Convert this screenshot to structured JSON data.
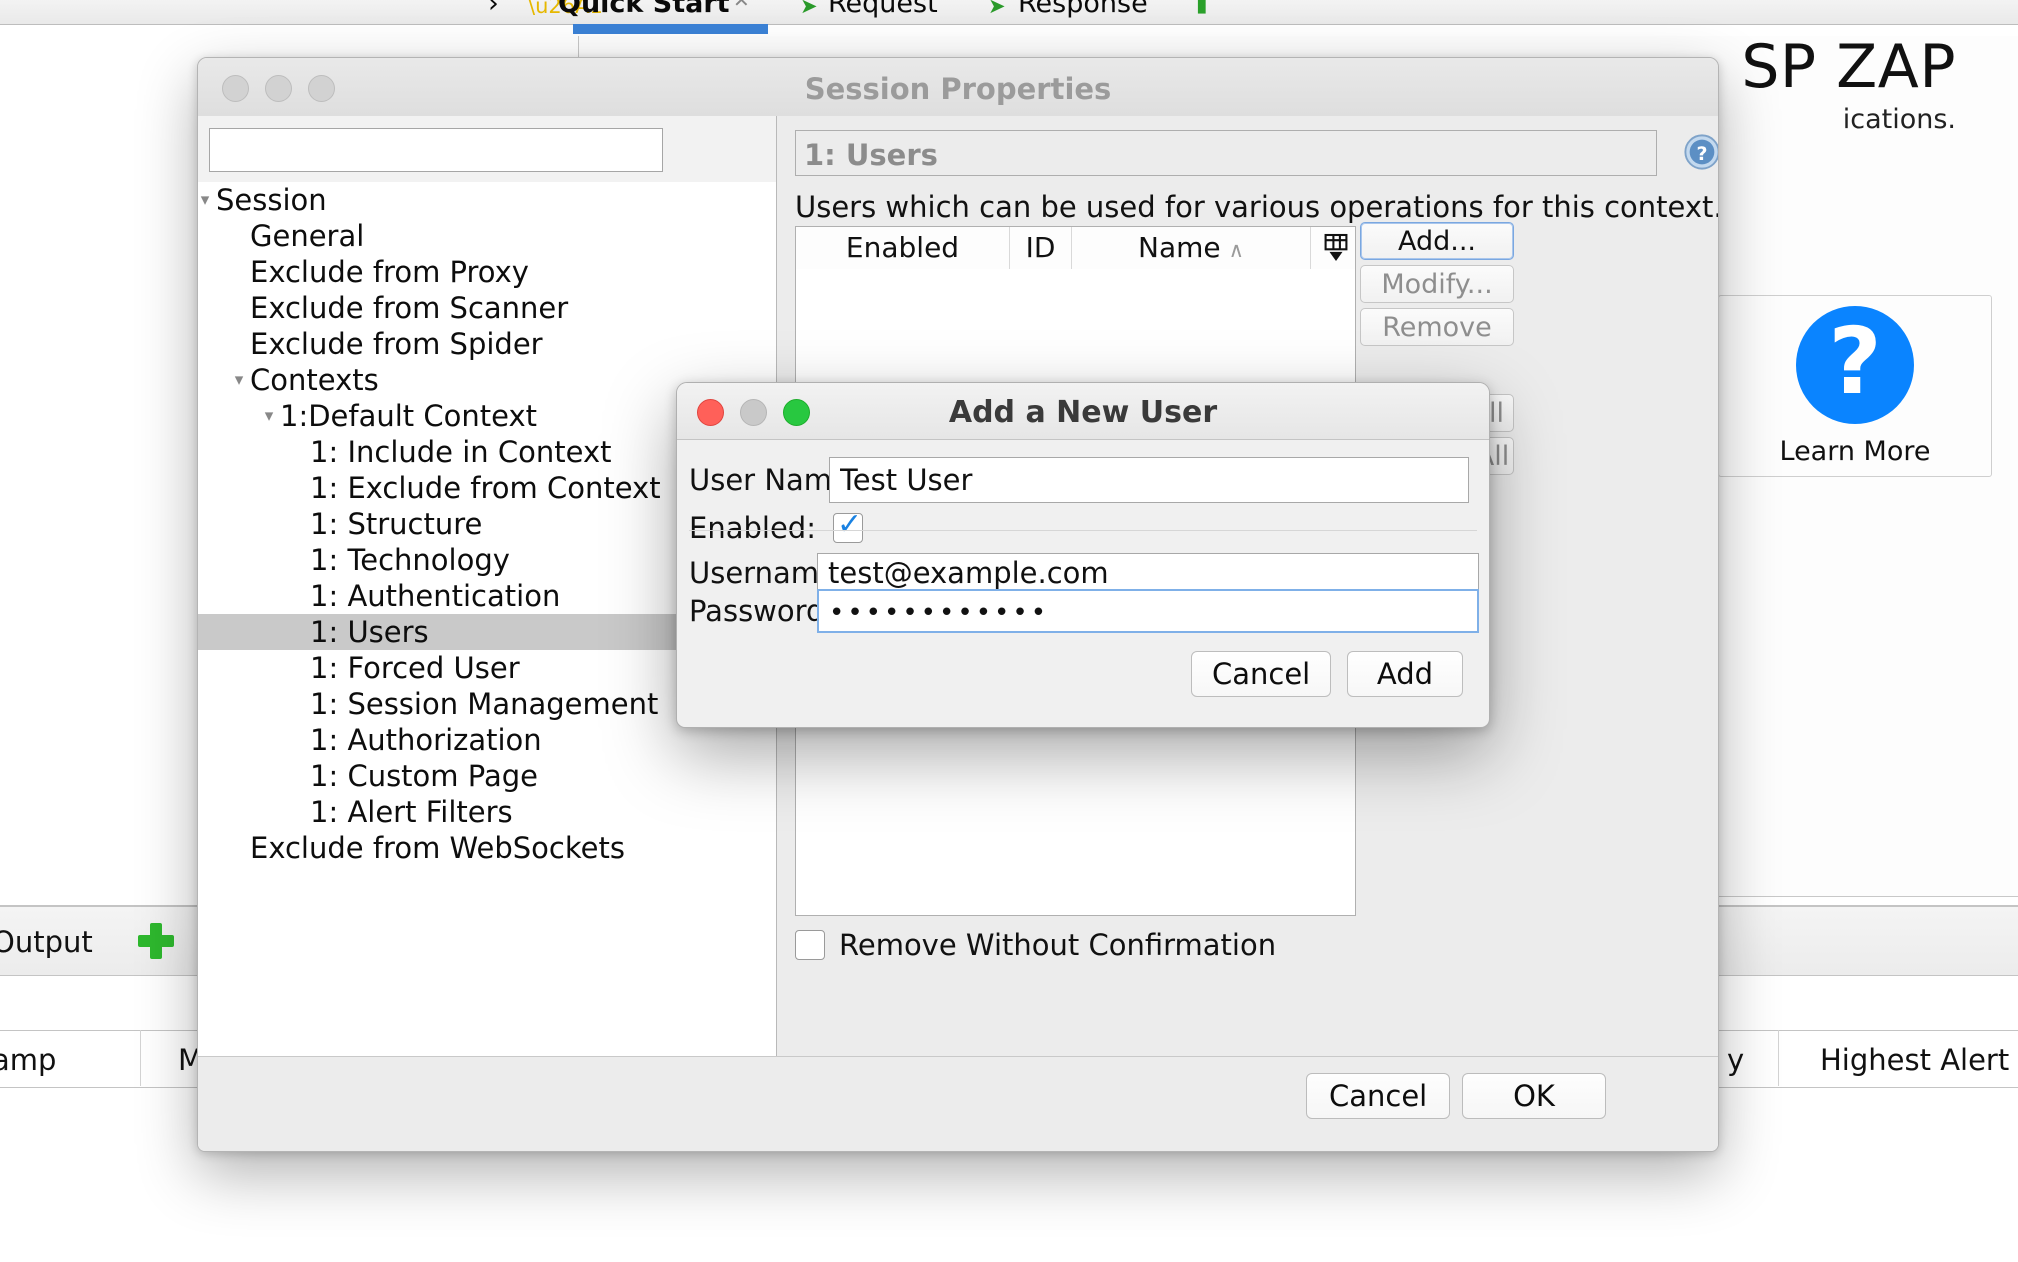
{
  "background": {
    "tabs": [
      {
        "label": "Quick Start",
        "icon": "lightning-icon",
        "selected": true
      },
      {
        "label": "Request",
        "icon": "green-arrow-right-icon",
        "selected": false
      },
      {
        "label": "Response",
        "icon": "green-arrow-left-icon",
        "selected": false
      }
    ],
    "chevron": "›",
    "app_title": "SP ZAP",
    "app_subtitle": "ications.",
    "learn_more_label": "Learn More",
    "learn_more_icon": "question-mark-icon",
    "output_tab_label": "Output",
    "add_tab_icon": "green-plus-icon",
    "table_headers": [
      {
        "label": "amp"
      },
      {
        "label": "M"
      },
      {
        "label": "y"
      },
      {
        "label": "Highest Alert"
      }
    ]
  },
  "session_properties": {
    "title": "Session Properties",
    "search": {
      "value": "",
      "placeholder": "",
      "search_icon": "magnifier-icon",
      "clear_icon": "red-x-icon"
    },
    "tree": [
      {
        "label": "Session",
        "depth": 0,
        "caret": "⌄",
        "selected": false
      },
      {
        "label": "General",
        "depth": 1,
        "caret": "",
        "selected": false
      },
      {
        "label": "Exclude from Proxy",
        "depth": 1,
        "caret": "",
        "selected": false
      },
      {
        "label": "Exclude from Scanner",
        "depth": 1,
        "caret": "",
        "selected": false
      },
      {
        "label": "Exclude from Spider",
        "depth": 1,
        "caret": "",
        "selected": false
      },
      {
        "label": "Contexts",
        "depth": 1,
        "caret": "⌄",
        "selected": false
      },
      {
        "label": "1:Default Context",
        "depth": 2,
        "caret": "⌄",
        "selected": false
      },
      {
        "label": "1: Include in Context",
        "depth": 3,
        "caret": "",
        "selected": false
      },
      {
        "label": "1: Exclude from Context",
        "depth": 3,
        "caret": "",
        "selected": false
      },
      {
        "label": "1: Structure",
        "depth": 3,
        "caret": "",
        "selected": false
      },
      {
        "label": "1: Technology",
        "depth": 3,
        "caret": "",
        "selected": false
      },
      {
        "label": "1: Authentication",
        "depth": 3,
        "caret": "",
        "selected": false
      },
      {
        "label": "1: Users",
        "depth": 3,
        "caret": "",
        "selected": true
      },
      {
        "label": "1: Forced User",
        "depth": 3,
        "caret": "",
        "selected": false
      },
      {
        "label": "1: Session Management",
        "depth": 3,
        "caret": "",
        "selected": false
      },
      {
        "label": "1: Authorization",
        "depth": 3,
        "caret": "",
        "selected": false
      },
      {
        "label": "1: Custom Page",
        "depth": 3,
        "caret": "",
        "selected": false
      },
      {
        "label": "1: Alert Filters",
        "depth": 3,
        "caret": "",
        "selected": false
      },
      {
        "label": "Exclude from WebSockets",
        "depth": 1,
        "caret": "",
        "selected": false
      }
    ],
    "panel": {
      "header": "1: Users",
      "help_icon": "help-question-icon",
      "description": "Users which can be used for various operations for this context.",
      "table": {
        "columns": [
          "Enabled",
          "ID",
          "Name"
        ],
        "sort_column": "Name",
        "sort_direction": "∧",
        "column_chooser_icon": "table-columns-icon",
        "rows": []
      },
      "buttons": [
        {
          "label": "Add...",
          "enabled": true
        },
        {
          "label": "Modify...",
          "enabled": false
        },
        {
          "label": "Remove",
          "enabled": false
        },
        {
          "label": "Enable All",
          "enabled": false
        },
        {
          "label": "Disable All",
          "enabled": false
        }
      ],
      "remove_without_confirmation": {
        "label": "Remove Without Confirmation",
        "checked": false
      }
    },
    "footer": {
      "cancel_label": "Cancel",
      "ok_label": "OK"
    }
  },
  "add_user_dialog": {
    "title": "Add a New User",
    "user_name": {
      "label": "User Name:",
      "value": "Test User"
    },
    "enabled": {
      "label": "Enabled:",
      "checked": true
    },
    "username": {
      "label": "Username:",
      "value": "test@example.com"
    },
    "password": {
      "label": "Password:",
      "value": "••••••••••••"
    },
    "cancel_label": "Cancel",
    "add_label": "Add"
  },
  "colors": {
    "accent_blue": "#0a84ff",
    "selection_gray": "#c9c9c9",
    "traffic_red": "#ff6059",
    "traffic_green": "#28c840",
    "focus_border": "#7fb0e8",
    "tab_underline": "#3b82d6",
    "plus_green": "#2eb82e"
  }
}
